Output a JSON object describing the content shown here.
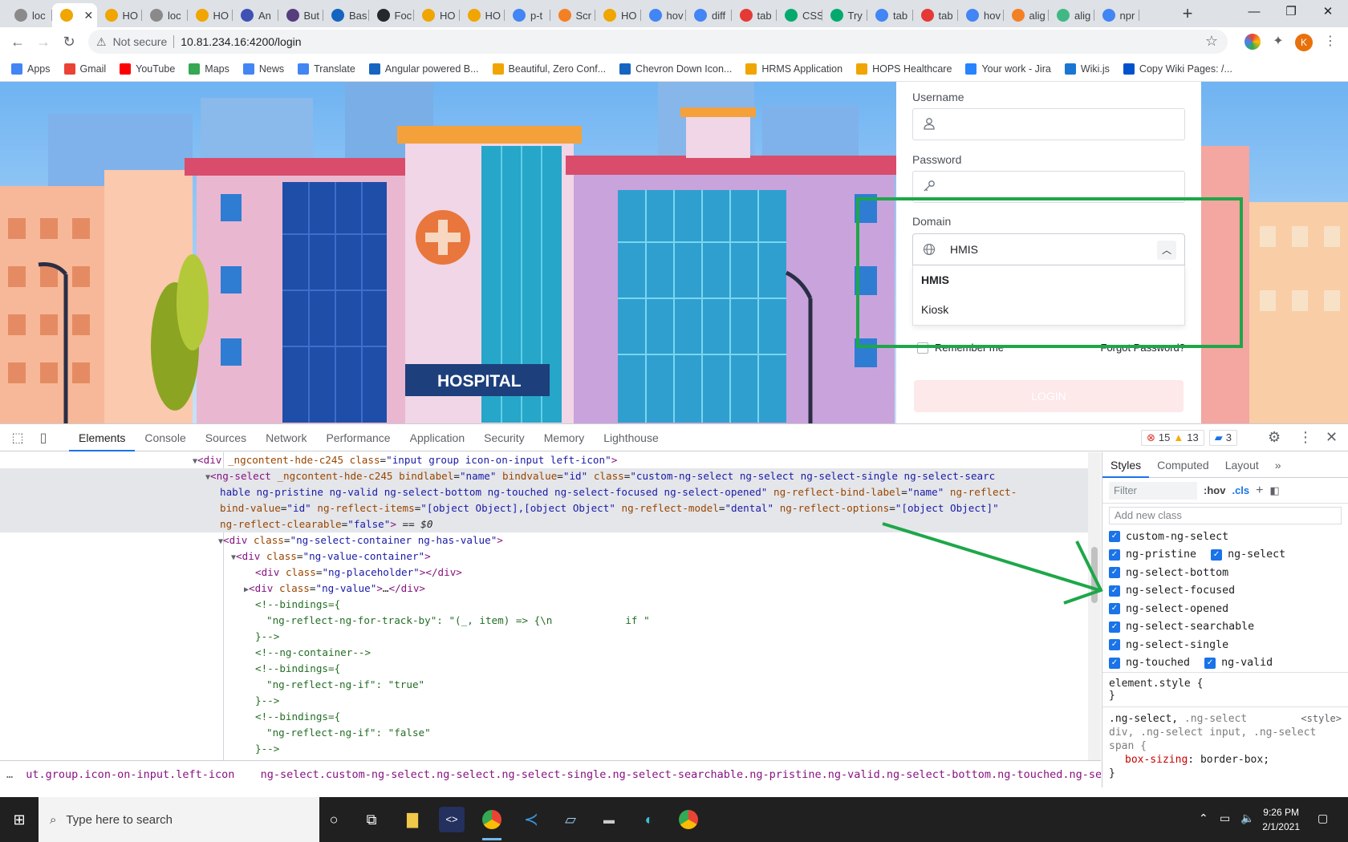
{
  "browser": {
    "tabs": [
      {
        "label": "loc",
        "icon": "globe-icon",
        "color": "#8a8a8a"
      },
      {
        "label": "",
        "icon": "app-icon",
        "color": "#f0a500",
        "active": true
      },
      {
        "label": "HO",
        "icon": "app-icon",
        "color": "#f0a500"
      },
      {
        "label": "loc",
        "icon": "globe-icon",
        "color": "#8a8a8a"
      },
      {
        "label": "HO",
        "icon": "app-icon",
        "color": "#f0a500"
      },
      {
        "label": "An",
        "icon": "bootstrap-icon",
        "color": "#3f51b5"
      },
      {
        "label": "But",
        "icon": "bootstrap-icon",
        "color": "#563d7c"
      },
      {
        "label": "Bas",
        "icon": "flag-icon",
        "color": "#1565c0"
      },
      {
        "label": "Foc",
        "icon": "github-icon",
        "color": "#24292e"
      },
      {
        "label": "HO",
        "icon": "app-icon",
        "color": "#f0a500"
      },
      {
        "label": "HO",
        "icon": "app-icon",
        "color": "#f0a500"
      },
      {
        "label": "p-t",
        "icon": "google-icon",
        "color": "#4285f4"
      },
      {
        "label": "Scr",
        "icon": "stack-icon",
        "color": "#f48024"
      },
      {
        "label": "HO",
        "icon": "app-icon",
        "color": "#f0a500"
      },
      {
        "label": "hov",
        "icon": "google-icon",
        "color": "#4285f4"
      },
      {
        "label": "diff",
        "icon": "google-icon",
        "color": "#4285f4"
      },
      {
        "label": "tab",
        "icon": "asterisk-icon",
        "color": "#e53935"
      },
      {
        "label": "CSS",
        "icon": "w3-icon",
        "color": "#04aa6d"
      },
      {
        "label": "Try",
        "icon": "w3-icon",
        "color": "#04aa6d"
      },
      {
        "label": "tab",
        "icon": "google-icon",
        "color": "#4285f4"
      },
      {
        "label": "tab",
        "icon": "asterisk-icon",
        "color": "#e53935"
      },
      {
        "label": "hov",
        "icon": "google-icon",
        "color": "#4285f4"
      },
      {
        "label": "alig",
        "icon": "stack-icon",
        "color": "#f48024"
      },
      {
        "label": "alig",
        "icon": "vue-icon",
        "color": "#41b883"
      },
      {
        "label": "npr",
        "icon": "google-icon",
        "color": "#4285f4"
      }
    ],
    "new_tab": "+",
    "window": {
      "minimize": "—",
      "restore": "❐",
      "close": "✕"
    },
    "nav": {
      "back": "←",
      "forward": "→",
      "reload": "↻"
    },
    "address": {
      "security": "Not secure",
      "url": "10.81.234.16:4200/login"
    },
    "profile_initial": "K",
    "bookmarks": [
      {
        "label": "Apps",
        "icon": "apps-grid-icon",
        "color": "#4285f4"
      },
      {
        "label": "Gmail",
        "icon": "gmail-icon",
        "color": "#ea4335"
      },
      {
        "label": "YouTube",
        "icon": "youtube-icon",
        "color": "#ff0000"
      },
      {
        "label": "Maps",
        "icon": "maps-pin-icon",
        "color": "#34a853"
      },
      {
        "label": "News",
        "icon": "news-icon",
        "color": "#4285f4"
      },
      {
        "label": "Translate",
        "icon": "translate-icon",
        "color": "#4285f4"
      },
      {
        "label": "Angular powered B...",
        "icon": "bootstrap-icon",
        "color": "#1565c0"
      },
      {
        "label": "Beautiful, Zero Conf...",
        "icon": "doc-icon",
        "color": "#f0a500"
      },
      {
        "label": "Chevron Down Icon...",
        "icon": "flag-icon",
        "color": "#1565c0"
      },
      {
        "label": "HRMS Application",
        "icon": "app-icon",
        "color": "#f0a500"
      },
      {
        "label": "HOPS Healthcare",
        "icon": "app-icon",
        "color": "#f0a500"
      },
      {
        "label": "Your work - Jira",
        "icon": "jira-icon",
        "color": "#2684ff"
      },
      {
        "label": "Wiki.js",
        "icon": "wiki-icon",
        "color": "#1976d2"
      },
      {
        "label": "Copy Wiki Pages: /...",
        "icon": "confluence-icon",
        "color": "#0052cc"
      }
    ]
  },
  "login": {
    "username_label": "Username",
    "password_label": "Password",
    "domain_label": "Domain",
    "domain_value": "HMIS",
    "options": [
      "HMIS",
      "Kiosk"
    ],
    "remember": "Remember me",
    "forgot": "Forgot Password?",
    "login_button": "LOGIN",
    "sign_text": "HOSPITAL"
  },
  "devtools": {
    "tabs": [
      "Elements",
      "Console",
      "Sources",
      "Network",
      "Performance",
      "Application",
      "Security",
      "Memory",
      "Lighthouse"
    ],
    "errors": "15",
    "warnings": "13",
    "messages": "3",
    "breadcrumb_1": "ut.group.icon-on-input.left-icon",
    "breadcrumb_2": "ng-select.custom-ng-select.ng-select.ng-select-single.ng-select-searchable.ng-pristine.ng-valid.ng-select-bottom.ng-touched.ng-select-focused.ng-select-opened",
    "styles_tabs": [
      "Styles",
      "Computed",
      "Layout",
      "»"
    ],
    "filter_placeholder": "Filter",
    "hov": ":hov",
    "cls": ".cls",
    "add_class_placeholder": "Add new class",
    "classes": [
      [
        "custom-ng-select"
      ],
      [
        "ng-pristine",
        "ng-select"
      ],
      [
        "ng-select-bottom"
      ],
      [
        "ng-select-focused"
      ],
      [
        "ng-select-opened"
      ],
      [
        "ng-select-searchable"
      ],
      [
        "ng-select-single"
      ],
      [
        "ng-touched",
        "ng-valid"
      ]
    ],
    "element_style": "element.style {",
    "element_style_close": "}",
    "rule_selector_1": ".ng-select,",
    "rule_selector_2": ".ng-select",
    "rule_selector_3": "div, .ng-select input, .ng-select",
    "rule_selector_4": "span {",
    "rule_source": "<style>",
    "rule_prop": "box-sizing",
    "rule_val": "border-box;",
    "rule_close": "}"
  },
  "taskbar": {
    "search": "Type here to search",
    "time": "9:26 PM",
    "date": "2/1/2021"
  }
}
